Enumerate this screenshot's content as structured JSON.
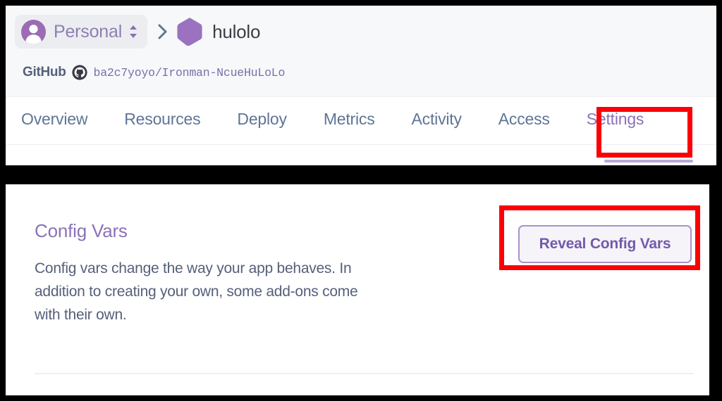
{
  "header": {
    "team": {
      "name": "Personal",
      "avatar_icon": "person-avatar-icon",
      "selector_icon": "chevron-up-down-icon"
    },
    "separator_icon": "chevron-right-icon",
    "app": {
      "name": "hulolo",
      "icon": "hexagon-app-icon"
    },
    "repo": {
      "label": "GitHub",
      "icon": "github-octocat-icon",
      "path": "ba2c7yoyo/Ironman-NcueHuLoLo"
    }
  },
  "tabs": [
    {
      "label": "Overview",
      "active": false
    },
    {
      "label": "Resources",
      "active": false
    },
    {
      "label": "Deploy",
      "active": false
    },
    {
      "label": "Metrics",
      "active": false
    },
    {
      "label": "Activity",
      "active": false
    },
    {
      "label": "Access",
      "active": false
    },
    {
      "label": "Settings",
      "active": true
    }
  ],
  "config_vars": {
    "title": "Config Vars",
    "description": "Config vars change the way your app behaves. In addition to creating your own, some add-ons come with their own.",
    "reveal_button_label": "Reveal Config Vars"
  },
  "annotations": [
    {
      "target": "settings-tab",
      "color": "#fb0007"
    },
    {
      "target": "reveal-config-vars-button",
      "color": "#fb0007"
    }
  ],
  "colors": {
    "accent_purple": "#8a72b8",
    "tab_text": "#5f7596",
    "body_text": "#55607a",
    "button_border": "#a992ca",
    "button_text": "#7459ab",
    "annotation_red": "#fb0007",
    "header_bg": "#f7f8fa"
  }
}
